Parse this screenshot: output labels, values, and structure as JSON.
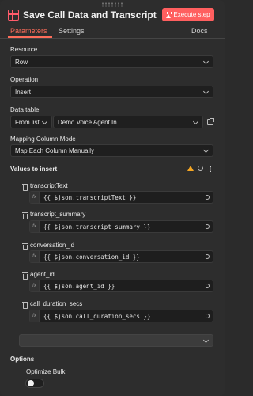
{
  "header": {
    "title": "Save Call Data and Transcript",
    "execute_label": "Execute step"
  },
  "tabs": [
    {
      "label": "Parameters",
      "active": true
    },
    {
      "label": "Settings",
      "active": false
    }
  ],
  "docs_label": "Docs",
  "fields": {
    "resource": {
      "label": "Resource",
      "value": "Row"
    },
    "operation": {
      "label": "Operation",
      "value": "Insert"
    },
    "data_table": {
      "label": "Data table",
      "mode": "From list",
      "value": "Demo Voice Agent In"
    },
    "mapping": {
      "label": "Mapping Column Mode",
      "value": "Map Each Column Manually"
    }
  },
  "values_section": {
    "title": "Values to insert",
    "columns": [
      {
        "name": "transcriptText",
        "expression": "{{ $json.transcriptText }}"
      },
      {
        "name": "transcript_summary",
        "expression": "{{ $json.transcript_summary }}"
      },
      {
        "name": "conversation_id",
        "expression": "{{ $json.conversation_id }}"
      },
      {
        "name": "agent_id",
        "expression": "{{ $json.agent_id }}"
      },
      {
        "name": "call_duration_secs",
        "expression": "{{ $json.call_duration_secs }}"
      }
    ],
    "fx_label": "fx"
  },
  "options": {
    "title": "Options",
    "optimize_label": "Optimize Bulk",
    "optimize_on": false
  },
  "colors": {
    "accent": "#ff6d5a",
    "execute_button": "#ff5f5f",
    "warning": "#f5a623"
  },
  "icons": {
    "node": "table-icon",
    "execute": "flask-icon",
    "warning": "warning-icon",
    "refresh": "refresh-icon",
    "more": "kebab-icon",
    "delete": "trash-icon",
    "external": "external-link-icon"
  }
}
